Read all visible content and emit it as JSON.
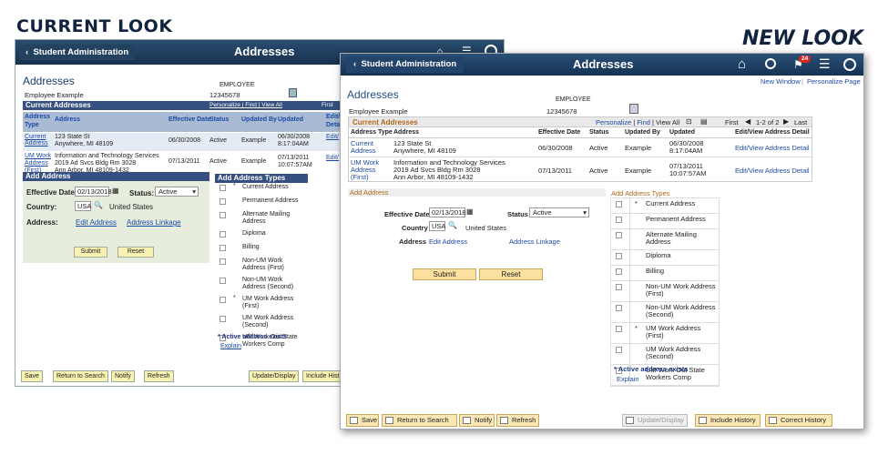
{
  "labels": {
    "current": "CURRENT LOOK",
    "new": "NEW LOOK"
  },
  "old": {
    "nav": "Student Administration",
    "title": "Addresses",
    "page_heading": "Addresses",
    "employee_label": "EMPLOYEE",
    "name": "Employee Example",
    "id": "12345678",
    "section": "Current Addresses",
    "personalize": "Personalize",
    "find": "Find",
    "view_all": "View All",
    "first": "First",
    "cols": [
      "Address Type",
      "Address",
      "Effective Date",
      "Status",
      "Updated By",
      "Updated",
      "Edit/ Detail"
    ],
    "rows": [
      {
        "type": "Current Address",
        "addr": "123 State St\nAnywhere, MI 48109",
        "date": "06/30/2008",
        "status": "Active",
        "by": "Example",
        "updated": "06/30/2008\n8:17:04AM",
        "edit": "Edit/"
      },
      {
        "type": "UM Work Address (First)",
        "addr": "Information and Technology Services\n2019 Ad Svcs Bldg Rm 3028\nAnn Arbor, MI 48109-1432",
        "date": "07/13/2011",
        "status": "Active",
        "by": "Example",
        "updated": "07/13/2011\n10:07:57AM",
        "edit": "Edit/"
      }
    ],
    "add_address": "Add Address",
    "eff_date_label": "Effective Date:",
    "eff_date": "02/13/2018",
    "status_label": "Status:",
    "status": "Active",
    "country_label": "Country:",
    "country": "USA",
    "country_name": "United States",
    "address_label": "Address:",
    "edit_address": "Edit Address",
    "address_linkage": "Address Linkage",
    "submit": "Submit",
    "reset": "Reset",
    "types_title": "Add Address Types",
    "types": [
      "Current Address",
      "Permanent Address",
      "Alternate Mailing Address",
      "Diploma",
      "Billing",
      "Non-UM Work Address (First)",
      "Non-UM Work Address (Second)",
      "UM Work Address (First)",
      "UM Work Address (Second)",
      "UM Work Out State Workers Comp"
    ],
    "active_note": "* Active address exists",
    "explain": "Explain",
    "footer": [
      "Save",
      "Return to Search",
      "Notify",
      "Refresh",
      "Update/Display",
      "Include Hist"
    ]
  },
  "new": {
    "nav": "Student Administration",
    "title": "Addresses",
    "badge": "24",
    "new_window": "New Window",
    "personalize_page": "Personalize Page",
    "page_heading": "Addresses",
    "employee_label": "EMPLOYEE",
    "name": "Employee Example",
    "id": "12345678",
    "section": "Current Addresses",
    "personalize": "Personalize",
    "find": "Find",
    "view_all": "View All",
    "pager": "1-2 of 2",
    "first": "First",
    "last": "Last",
    "cols": [
      "Address Type",
      "Address",
      "Effective Date",
      "Status",
      "Updated By",
      "Updated",
      "Edit/View Address Detail"
    ],
    "rows": [
      {
        "type": "Current Address",
        "addr": "123 State St\nAnywhere, MI 48109",
        "date": "06/30/2008",
        "status": "Active",
        "by": "Example",
        "updated": "06/30/2008\n8:17:04AM",
        "edit": "Edit/View Address Detail"
      },
      {
        "type": "UM Work Address (First)",
        "addr": "Information and Technology Services\n2019 Ad Svcs Bldg Rm 3028\nAnn Arbor, MI 48109-1432",
        "date": "07/13/2011",
        "status": "Active",
        "by": "Example",
        "updated": "07/13/2011\n10:07:57AM",
        "edit": "Edit/View Address Detail"
      }
    ],
    "add_address": "Add Address",
    "eff_date_label": "Effective Date",
    "eff_date": "02/13/2018",
    "status_label": "Status",
    "status": "Active",
    "country_label": "Country",
    "country": "USA",
    "country_name": "United States",
    "address_label": "Address",
    "edit_address": "Edit Address",
    "address_linkage": "Address Linkage",
    "submit": "Submit",
    "reset": "Reset",
    "types_title": "Add Address Types",
    "types": [
      "Current Address",
      "Permanent Address",
      "Alternate Mailing Address",
      "Diploma",
      "Billing",
      "Non-UM Work Address (First)",
      "Non-UM Work Address (Second)",
      "UM Work Address (First)",
      "UM Work Address (Second)",
      "UM Work Out State Workers Comp"
    ],
    "active_note": "* Active address exists",
    "explain": "Explain",
    "footer": [
      "Save",
      "Return to Search",
      "Notify",
      "Refresh",
      "Update/Display",
      "Include History",
      "Correct History"
    ]
  }
}
